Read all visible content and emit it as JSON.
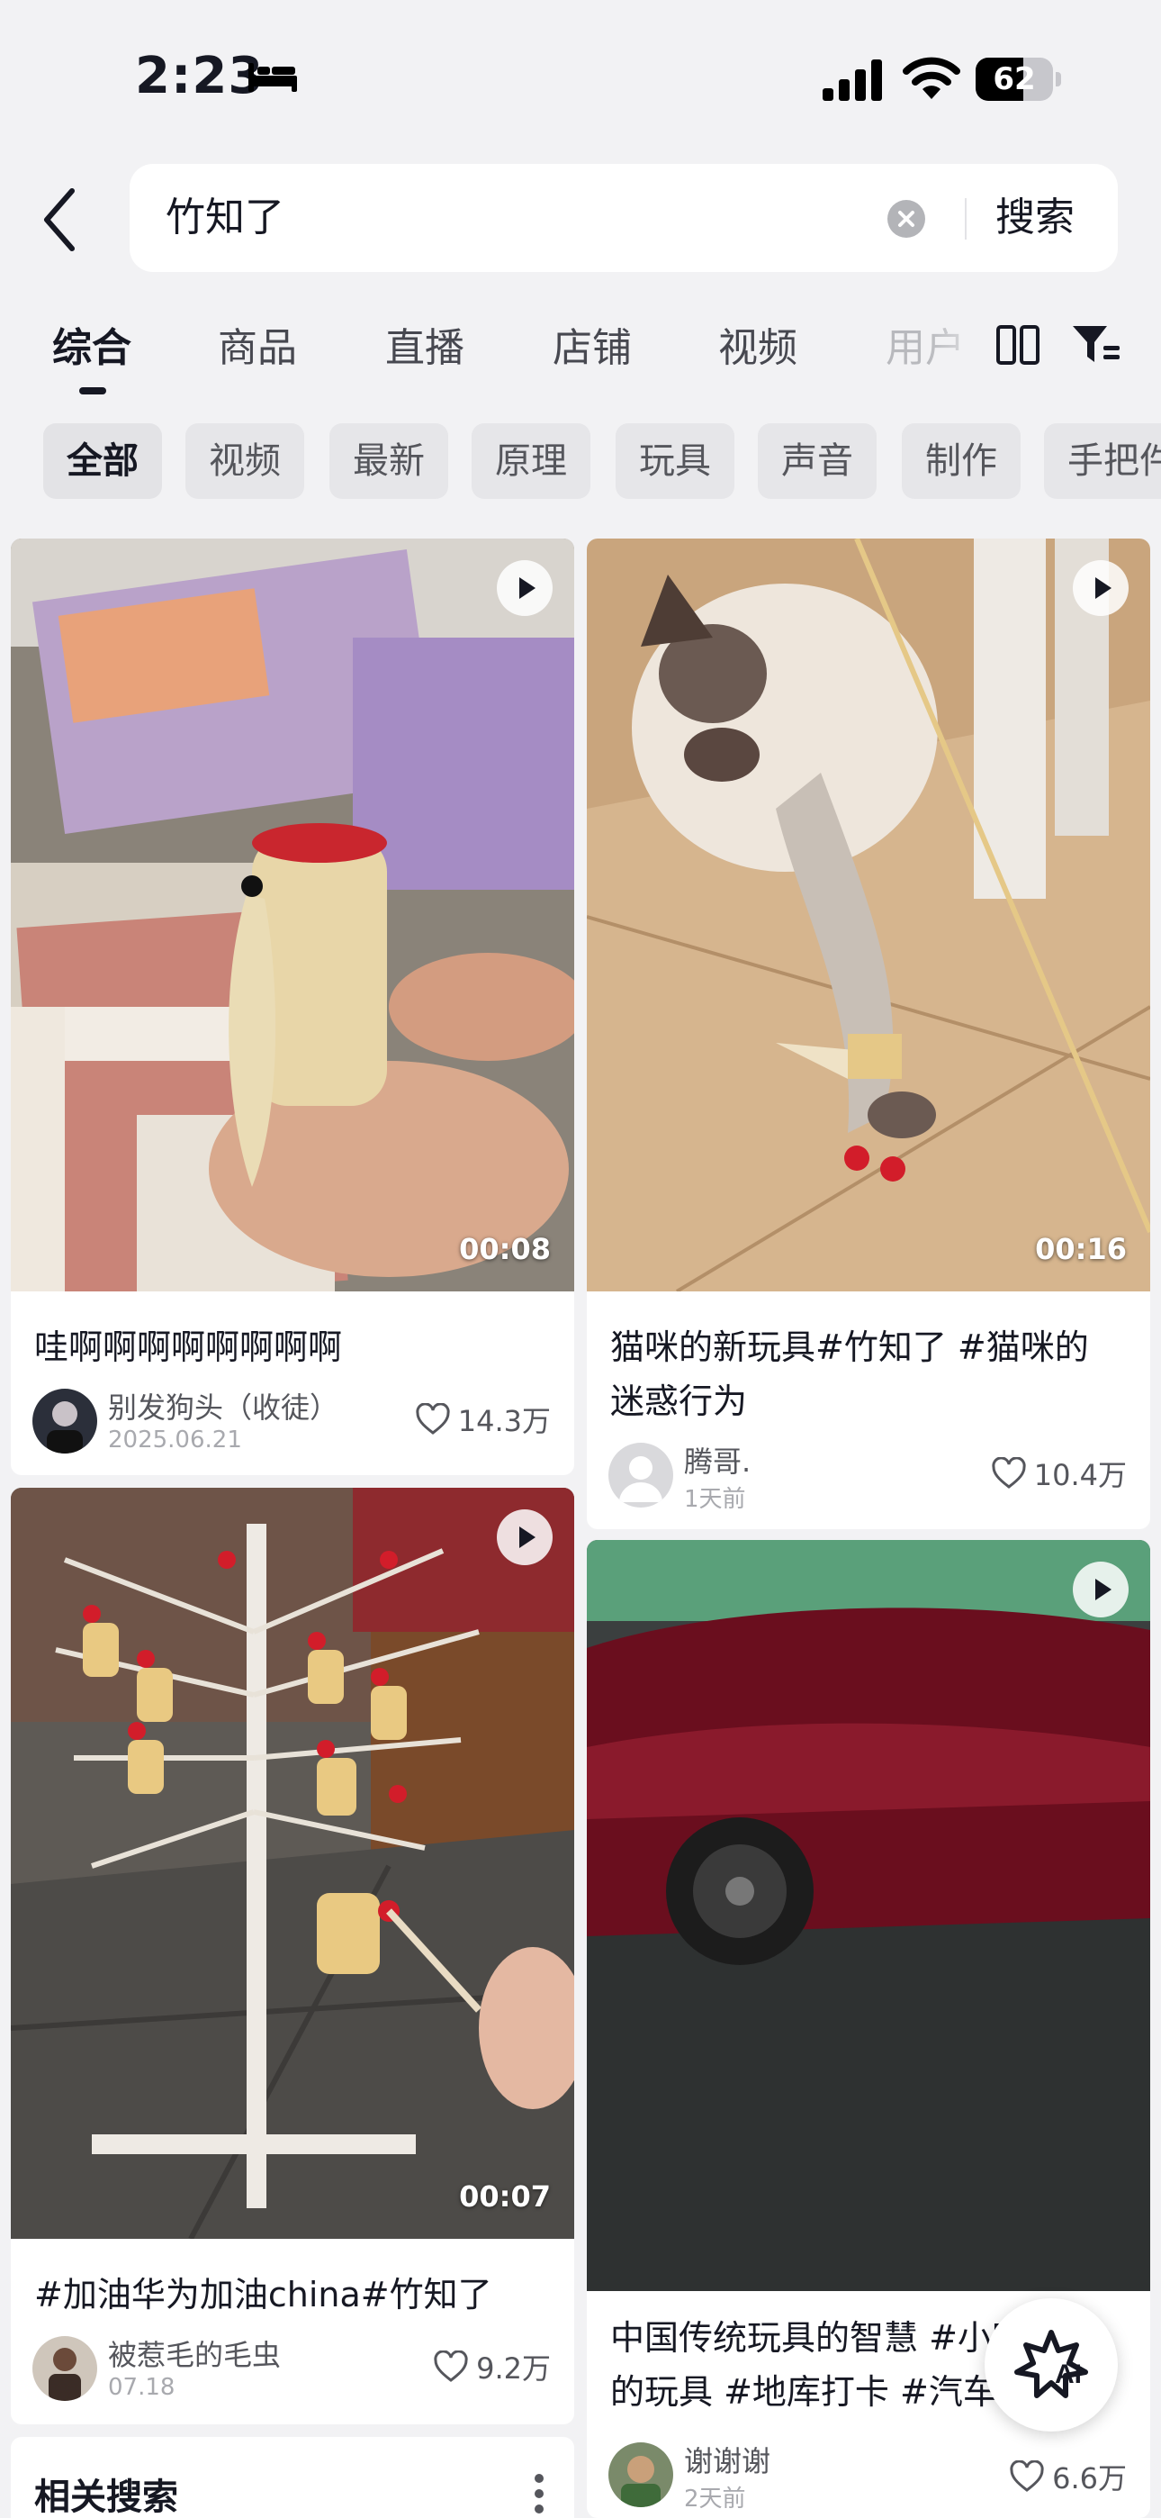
{
  "status": {
    "time": "2:23",
    "battery": "62",
    "battery_level": 0.62
  },
  "search": {
    "query": "竹知了",
    "submit_label": "搜索"
  },
  "tabs": [
    "综合",
    "商品",
    "直播",
    "店铺",
    "视频",
    "用户"
  ],
  "chips": [
    "全部",
    "视频",
    "最新",
    "原理",
    "玩具",
    "声音",
    "制作",
    "手把件"
  ],
  "cards": [
    {
      "title": "哇啊啊啊啊啊啊啊啊",
      "duration": "00:08",
      "author": "别发狗头（收徒）",
      "date": "2025.06.21",
      "likes": "14.3万",
      "thumb": "cicada toy on book"
    },
    {
      "title_line1": "猫咪的新玩具#竹知了 #猫咪的",
      "title_line2": "迷惑行为",
      "duration": "00:16",
      "author": "腾哥.",
      "date": "1天前",
      "likes": "10.4万",
      "thumb": "siamese cat with toy"
    },
    {
      "title": "#加油华为加油china#竹知了",
      "duration": "00:07",
      "author": "被惹毛的毛虫",
      "date": "07.18",
      "likes": "9.2万",
      "thumb": "toy rack"
    },
    {
      "title_line1": "中国传统玩具的智慧 #小时候",
      "title_line2": "的玩具 #地库打卡 #汽车...",
      "author": "谢谢谢",
      "date": "2天前",
      "likes": "6.6万",
      "thumb": "red car in garage"
    }
  ],
  "related": {
    "title": "相关搜索"
  },
  "ai": {
    "label": "AI"
  },
  "colors": {
    "accent": "#161823",
    "background": "#f2f2f4",
    "like_icon": "#55565c"
  },
  "icons": [
    "bed-icon",
    "signal-icon",
    "wifi-icon",
    "back-arrow-icon",
    "clear-icon",
    "layout-icon",
    "filter-icon",
    "play-icon",
    "heart-icon",
    "more-icon",
    "ai-icon"
  ]
}
